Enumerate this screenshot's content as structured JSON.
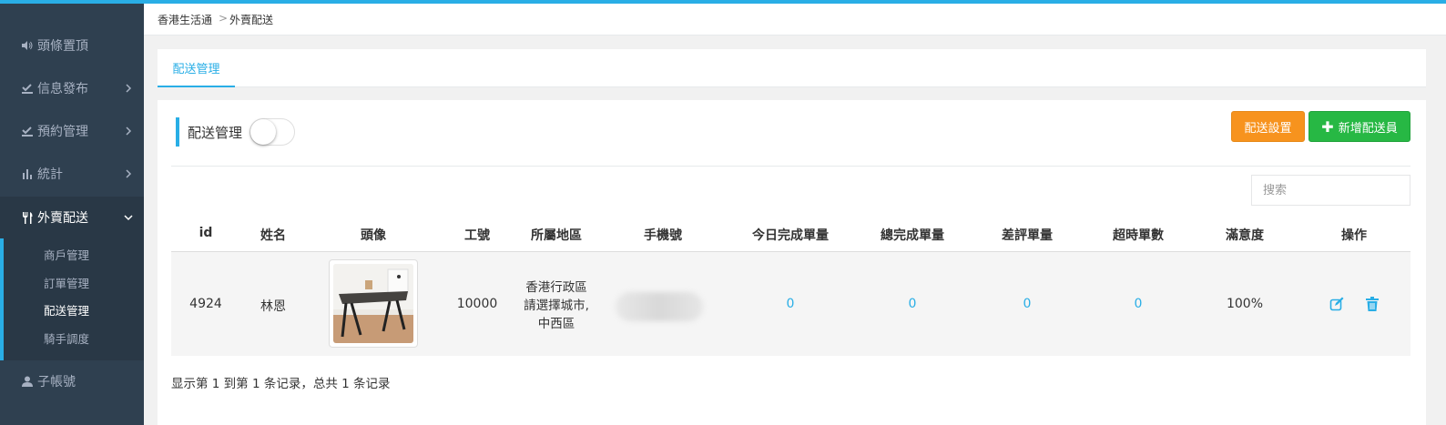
{
  "sidebar": {
    "items": [
      {
        "label": "頭條置頂",
        "icon": "volume-icon",
        "has_arrow": false
      },
      {
        "label": "信息發布",
        "icon": "checklist-icon",
        "has_arrow": true
      },
      {
        "label": "預約管理",
        "icon": "checklist-icon",
        "has_arrow": true
      },
      {
        "label": "統計",
        "icon": "bar-chart-icon",
        "has_arrow": true
      },
      {
        "label": "外賣配送",
        "icon": "cutlery-icon",
        "has_arrow": true,
        "expanded": true
      },
      {
        "label": "子帳號",
        "icon": "user-icon",
        "has_arrow": false
      }
    ],
    "sub_items": [
      "商戶管理",
      "訂單管理",
      "配送管理",
      "騎手調度"
    ],
    "current_sub": "配送管理"
  },
  "breadcrumb": {
    "home": "香港生活通",
    "current": "外賣配送"
  },
  "tabs": [
    {
      "label": "配送管理",
      "active": true
    }
  ],
  "section": {
    "title": "配送管理",
    "toggle_on": false
  },
  "buttons": {
    "settings": "配送設置",
    "add": "新增配送員"
  },
  "search": {
    "placeholder": "搜索",
    "value": ""
  },
  "table": {
    "columns": [
      "id",
      "姓名",
      "頭像",
      "工號",
      "所屬地區",
      "手機號",
      "今日完成單量",
      "總完成單量",
      "差評單量",
      "超時單數",
      "滿意度",
      "操作"
    ],
    "rows": [
      {
        "id": "4924",
        "name": "林恩",
        "avatar": "table-photo",
        "employee_no": "10000",
        "region": [
          "香港行政區",
          "請選擇城市,",
          "中西區"
        ],
        "phone": "",
        "today_orders": "0",
        "total_orders": "0",
        "bad_reviews": "0",
        "timeouts": "0",
        "satisfaction": "100%"
      }
    ]
  },
  "pagination": {
    "info": "显示第 1 到第 1 条记录，总共 1 条记录"
  },
  "colors": {
    "accent": "#29aee6",
    "sidebar_bg": "#2f4050",
    "orange": "#f7931e",
    "green": "#27b844"
  }
}
